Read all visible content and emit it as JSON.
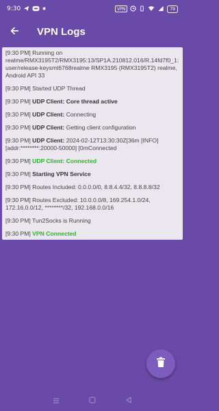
{
  "status_bar": {
    "time": "9:30",
    "left_icons": [
      "telegram-icon",
      "notification-icon",
      "dot-icon"
    ],
    "vpn_badge": "VPN",
    "battery": "79"
  },
  "app_bar": {
    "title": "VPN Logs"
  },
  "logs": [
    {
      "time": "[9:30 PM]",
      "label": "",
      "message": "Running on realme/RMX3195T2/RMX3195:13/SP1A.210812.016/R.14fd7f0_1:user/release-keysmt6768realme RMX3195 (RMX3195T2) realme, Android API 33",
      "style": "plain"
    },
    {
      "time": "[9:30 PM]",
      "label": "",
      "message": "Started UDP Thread",
      "style": "plain"
    },
    {
      "time": "[9:30 PM]",
      "label": "UDP Client:",
      "message": "Core thread active",
      "style": "bold"
    },
    {
      "time": "[9:30 PM]",
      "label": "UDP Client:",
      "message": "Connecting",
      "style": "label"
    },
    {
      "time": "[9:30 PM]",
      "label": "UDP Client:",
      "message": "Getting client configuration",
      "style": "label"
    },
    {
      "time": "[9:30 PM]",
      "label": "UDP Client:",
      "message": "2024-02-12T13:30:30Z[36m [INFO] [addr:********:20000-50000] [0mConnected",
      "style": "label"
    },
    {
      "time": "[9:30 PM]",
      "label": "UDP Client: Connected",
      "message": "",
      "style": "green"
    },
    {
      "time": "[9:30 PM]",
      "label": "Starting VPN Service",
      "message": "",
      "style": "bold"
    },
    {
      "time": "[9:30 PM]",
      "label": "",
      "message": "Routes Included: 0.0.0.0/0, 8.8.4.4/32, 8.8.8.8/32",
      "style": "plain"
    },
    {
      "time": "[9:30 PM]",
      "label": "",
      "message": "Routes Excluded: 10.0.0.0/8, 169.254.1.0/24, 172.16.0.0/12, ********/32, 192.168.0.0/16",
      "style": "plain"
    },
    {
      "time": "[9:30 PM]",
      "label": "",
      "message": "Tun2Socks is Running",
      "style": "plain"
    },
    {
      "time": "[9:30 PM]",
      "label": "VPN Connected",
      "message": "",
      "style": "green"
    }
  ],
  "colors": {
    "background": "#6a4aa8",
    "log_panel": "#eae7ee",
    "connected_green": "#2ab52a",
    "fab": "#7c5cbc"
  },
  "icons": {
    "back": "arrow-back-icon",
    "fab": "trash-icon",
    "nav": [
      "menu-icon",
      "home-icon",
      "back-triangle-icon"
    ]
  }
}
